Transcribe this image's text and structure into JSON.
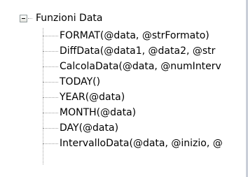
{
  "tree": {
    "root": {
      "label": "Funzioni Data",
      "expander_state": "expanded"
    },
    "items": [
      {
        "label": "FORMAT(@data, @strFormato)"
      },
      {
        "label": "DiffData(@data1, @data2, @str"
      },
      {
        "label": "CalcolaData(@data, @numInterv"
      },
      {
        "label": "TODAY()"
      },
      {
        "label": "YEAR(@data)"
      },
      {
        "label": "MONTH(@data)"
      },
      {
        "label": "DAY(@data)"
      },
      {
        "label": "IntervalloData(@data, @inizio, @"
      }
    ]
  }
}
